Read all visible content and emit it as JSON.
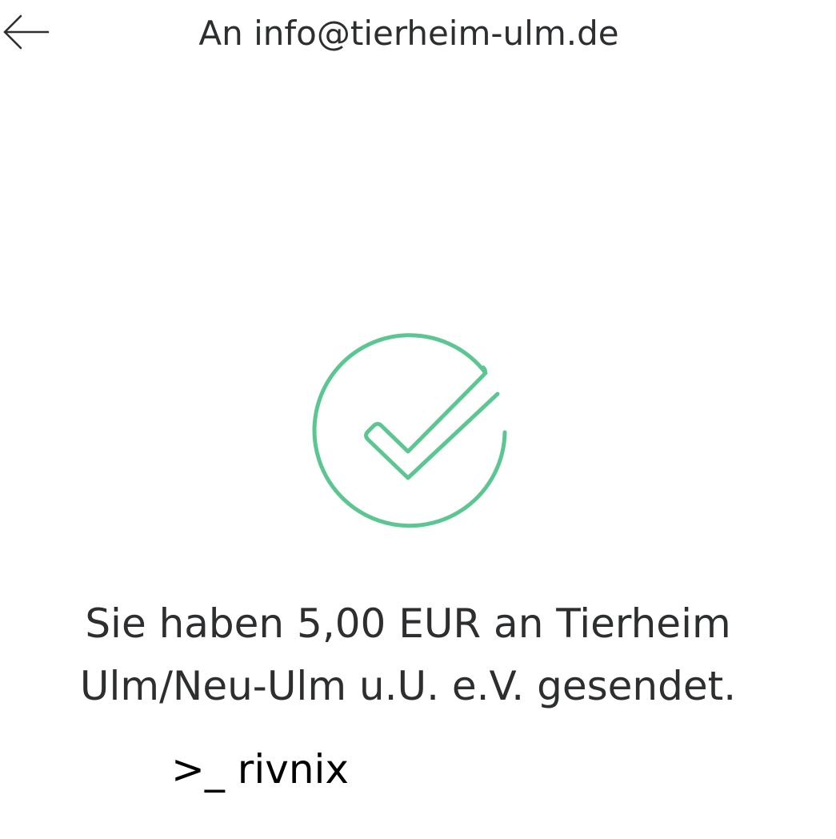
{
  "header": {
    "back_icon": "arrow-left-icon",
    "title": "An info@tierheim-ulm.de"
  },
  "success": {
    "icon": "checkmark-circle-icon",
    "icon_color": "#5bc691",
    "message": "Sie haben 5,00 EUR an Tierheim Ulm/Neu-Ulm u.U. e.V. gesendet."
  },
  "footer": {
    "brand_text": ">_ rivnix"
  },
  "colors": {
    "text": "#2c2e2f",
    "background": "#ffffff",
    "accent": "#5bc691"
  }
}
